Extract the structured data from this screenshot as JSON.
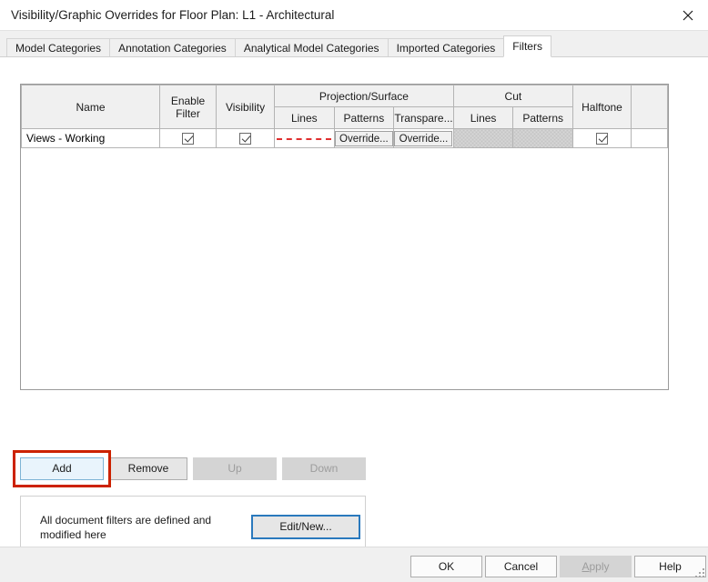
{
  "window": {
    "title": "Visibility/Graphic Overrides for Floor Plan: L1 - Architectural",
    "close_icon": "close-icon"
  },
  "tabs": [
    {
      "label": "Model Categories",
      "active": false
    },
    {
      "label": "Annotation Categories",
      "active": false
    },
    {
      "label": "Analytical Model Categories",
      "active": false
    },
    {
      "label": "Imported Categories",
      "active": false
    },
    {
      "label": "Filters",
      "active": true
    }
  ],
  "table": {
    "headers": {
      "name": "Name",
      "enable_filter": "Enable Filter",
      "enable_filter_line1": "Enable",
      "enable_filter_line2": "Filter",
      "visibility": "Visibility",
      "projection_surface": "Projection/Surface",
      "cut": "Cut",
      "halftone": "Halftone",
      "lines": "Lines",
      "patterns": "Patterns",
      "transparency": "Transpare...",
      "cut_lines": "Lines",
      "cut_patterns": "Patterns"
    },
    "rows": [
      {
        "name": "Views - Working",
        "enable_filter": true,
        "visibility": true,
        "projection_lines": "dashed-red-line",
        "projection_patterns": "Override...",
        "projection_transparency": "Override...",
        "cut_lines": "",
        "cut_patterns": "",
        "halftone": true
      }
    ]
  },
  "actions": {
    "add": "Add",
    "remove": "Remove",
    "up": "Up",
    "down": "Down"
  },
  "info": {
    "text": "All document filters are defined and modified here",
    "edit_new": "Edit/New..."
  },
  "footer": {
    "ok": "OK",
    "cancel": "Cancel",
    "apply": "Apply",
    "apply_mnemonic": "A",
    "apply_rest": "pply",
    "help": "Help"
  },
  "colors": {
    "accent": "#2a79bd",
    "hover": "#e9f4fc",
    "annotation": "#cc2200",
    "line_override": "#e03030"
  }
}
